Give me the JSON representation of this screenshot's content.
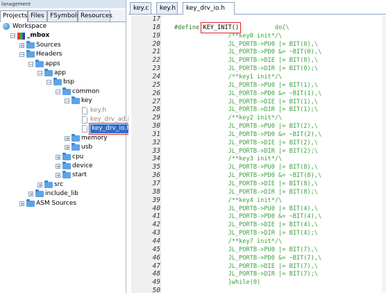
{
  "left_panel": {
    "title": "lanagement",
    "tabs": [
      "Projects",
      "Files",
      "FSymbols",
      "Resources"
    ],
    "tree": [
      {
        "label": "Workspace",
        "type": "workspace"
      },
      {
        "label": "_mbox",
        "type": "project"
      },
      {
        "label": "Sources",
        "type": "folder"
      },
      {
        "label": "Headers",
        "type": "folder"
      },
      {
        "label": "apps",
        "type": "folder"
      },
      {
        "label": "app",
        "type": "folder"
      },
      {
        "label": "bsp",
        "type": "folder"
      },
      {
        "label": "common",
        "type": "folder"
      },
      {
        "label": "key",
        "type": "folder"
      },
      {
        "label": "key.h",
        "type": "file"
      },
      {
        "label": "key_drv_ad.h",
        "type": "file"
      },
      {
        "label": "key_drv_io.h",
        "type": "file",
        "selected": true
      },
      {
        "label": "memory",
        "type": "folder"
      },
      {
        "label": "usb",
        "type": "folder"
      },
      {
        "label": "cpu",
        "type": "folder"
      },
      {
        "label": "device",
        "type": "folder"
      },
      {
        "label": "start",
        "type": "folder"
      },
      {
        "label": "src",
        "type": "folder"
      },
      {
        "label": "include_lib",
        "type": "folder"
      },
      {
        "label": "ASM Sources",
        "type": "folder"
      }
    ]
  },
  "editor": {
    "tabs": [
      "key.c",
      "key.h",
      "key_drv_io.h"
    ],
    "active_tab": "key_drv_io.h",
    "line_numbers": [
      "17",
      "18",
      "19",
      "20",
      "21",
      "22",
      "23",
      "24",
      "25",
      "26",
      "27",
      "28",
      "29",
      "30",
      "31",
      "32",
      "33",
      "34",
      "35",
      "36",
      "37",
      "38",
      "39",
      "40",
      "41",
      "42",
      "43",
      "44",
      "45",
      "46",
      "47",
      "48",
      "49",
      "50"
    ],
    "lines": [
      {
        "pre": "",
        "mid": "",
        "post": ""
      },
      {
        "pre": "#define ",
        "mid": "KEY_INIT()",
        "post": "          do{\\"
      },
      {
        "pre": "",
        "mid": "",
        "post": "               /**key0 init*/\\"
      },
      {
        "pre": "",
        "mid": "",
        "post": "               JL_PORTB->PU0 |= BIT(0),\\"
      },
      {
        "pre": "",
        "mid": "",
        "post": "               JL_PORTB->PD0 &= ~BIT(0),\\"
      },
      {
        "pre": "",
        "mid": "",
        "post": "               JL_PORTB->DIE |= BIT(0),\\"
      },
      {
        "pre": "",
        "mid": "",
        "post": "               JL_PORTB->DIR |= BIT(0);\\"
      },
      {
        "pre": "",
        "mid": "",
        "post": "               /**key1 init*/\\"
      },
      {
        "pre": "",
        "mid": "",
        "post": "               JL_PORTB->PU0 |= BIT(1),\\"
      },
      {
        "pre": "",
        "mid": "",
        "post": "               JL_PORTB->PD0 &= ~BIT(1),\\"
      },
      {
        "pre": "",
        "mid": "",
        "post": "               JL_PORTB->DIE |= BIT(1),\\"
      },
      {
        "pre": "",
        "mid": "",
        "post": "               JL_PORTB->DIR |= BIT(1);\\"
      },
      {
        "pre": "",
        "mid": "",
        "post": "               /**key2 init*/\\"
      },
      {
        "pre": "",
        "mid": "",
        "post": "               JL_PORTB->PU0 |= BIT(2),\\"
      },
      {
        "pre": "",
        "mid": "",
        "post": "               JL_PORTB->PD0 &= ~BIT(2),\\"
      },
      {
        "pre": "",
        "mid": "",
        "post": "               JL_PORTB->DIE |= BIT(2),\\"
      },
      {
        "pre": "",
        "mid": "",
        "post": "               JL_PORTB->DIR |= BIT(2);\\"
      },
      {
        "pre": "",
        "mid": "",
        "post": "               /**key3 init*/\\"
      },
      {
        "pre": "",
        "mid": "",
        "post": "               JL_PORTB->PU0 |= BIT(8),\\"
      },
      {
        "pre": "",
        "mid": "",
        "post": "               JL_PORTB->PD0 &= ~BIT(8),\\"
      },
      {
        "pre": "",
        "mid": "",
        "post": "               JL_PORTB->DIE |= BIT(8),\\"
      },
      {
        "pre": "",
        "mid": "",
        "post": "               JL_PORTB->DIR |= BIT(8);\\"
      },
      {
        "pre": "",
        "mid": "",
        "post": "               /**key4 init*/\\"
      },
      {
        "pre": "",
        "mid": "",
        "post": "               JL_PORTB->PU0 |= BIT(4),\\"
      },
      {
        "pre": "",
        "mid": "",
        "post": "               JL_PORTB->PD0 &= ~BIT(4),\\"
      },
      {
        "pre": "",
        "mid": "",
        "post": "               JL_PORTB->DIE |= BIT(4),\\"
      },
      {
        "pre": "",
        "mid": "",
        "post": "               JL_PORTB->DIR |= BIT(4);\\"
      },
      {
        "pre": "",
        "mid": "",
        "post": "               /**key7 init*/\\"
      },
      {
        "pre": "",
        "mid": "",
        "post": "               JL_PORTB->PU0 |= BIT(7),\\"
      },
      {
        "pre": "",
        "mid": "",
        "post": "               JL_PORTB->PD0 &= ~BIT(7),\\"
      },
      {
        "pre": "",
        "mid": "",
        "post": "               JL_PORTB->DIE |= BIT(7),\\"
      },
      {
        "pre": "",
        "mid": "",
        "post": "               JL_PORTB->DIR |= BIT(7);\\"
      },
      {
        "pre": "",
        "mid": "",
        "post": "               }while(0)"
      },
      {
        "pre": "",
        "mid": "",
        "post": ""
      }
    ]
  },
  "colors": {
    "code": "#3ba13b",
    "highlight_box": "#e02020",
    "selection": "#316ac5"
  }
}
